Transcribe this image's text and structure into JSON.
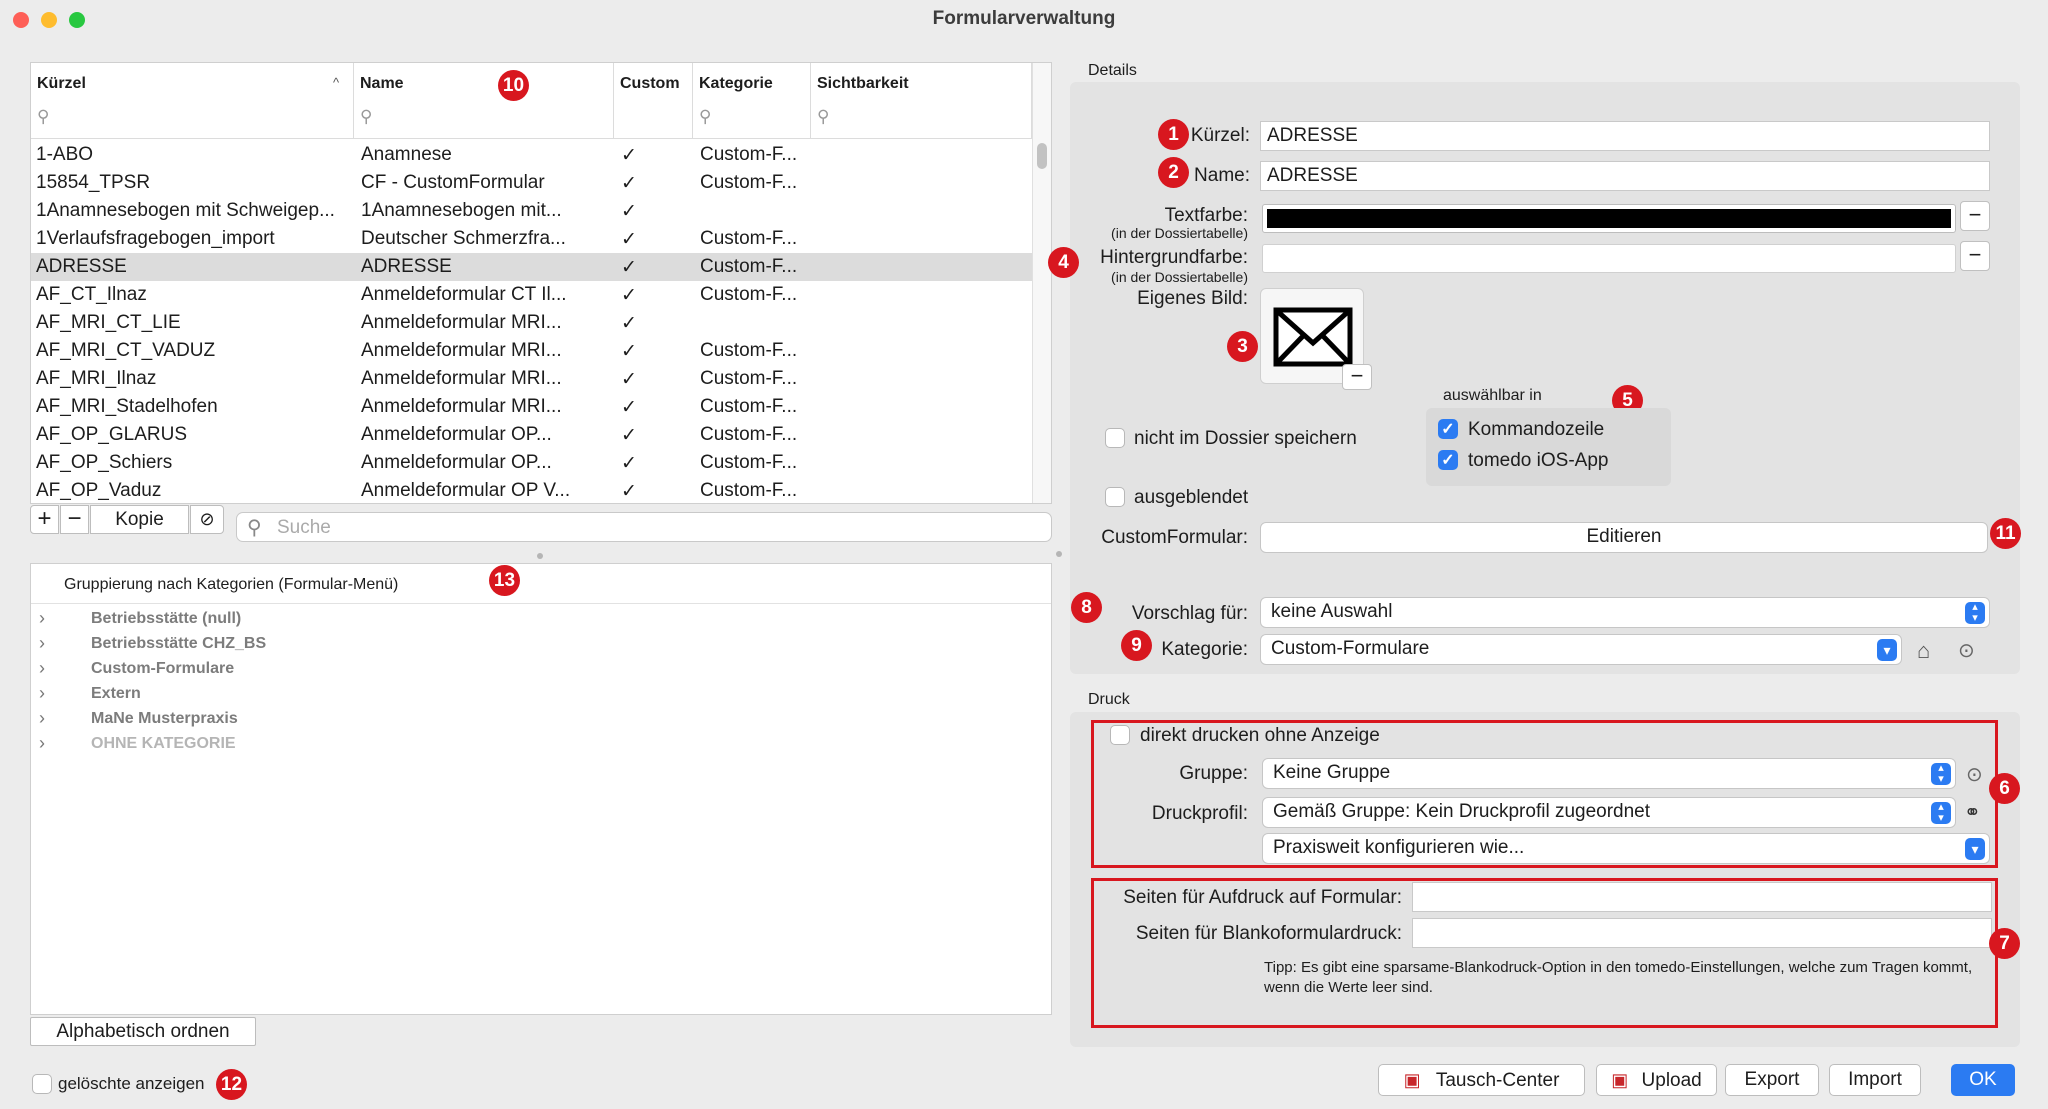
{
  "window": {
    "title": "Formularverwaltung"
  },
  "table": {
    "columns": [
      "Kürzel",
      "Name",
      "Custom",
      "Kategorie",
      "Sichtbarkeit"
    ],
    "rows": [
      [
        "1-ABO",
        "Anamnese",
        "✓",
        "Custom-F..."
      ],
      [
        "15854_TPSR",
        "CF - CustomFormular",
        "✓",
        "Custom-F..."
      ],
      [
        "1Anamnesebogen mit Schweigep...",
        "1Anamnesebogen mit...",
        "✓",
        ""
      ],
      [
        "1Verlaufsfragebogen_import",
        "Deutscher Schmerzfra...",
        "✓",
        "Custom-F..."
      ],
      [
        "ADRESSE",
        "ADRESSE",
        "✓",
        "Custom-F..."
      ],
      [
        "AF_CT_Ilnaz",
        "Anmeldeformular CT Il...",
        "✓",
        "Custom-F..."
      ],
      [
        "AF_MRI_CT_LIE",
        "Anmeldeformular MRI...",
        "✓",
        ""
      ],
      [
        "AF_MRI_CT_VADUZ",
        "Anmeldeformular MRI...",
        "✓",
        "Custom-F..."
      ],
      [
        "AF_MRI_Ilnaz",
        "Anmeldeformular MRI...",
        "✓",
        "Custom-F..."
      ],
      [
        "AF_MRI_Stadelhofen",
        "Anmeldeformular MRI...",
        "✓",
        "Custom-F..."
      ],
      [
        "AF_OP_GLARUS",
        "Anmeldeformular OP...",
        "✓",
        "Custom-F..."
      ],
      [
        "AF_OP_Schiers",
        "Anmeldeformular OP...",
        "✓",
        "Custom-F..."
      ],
      [
        "AF_OP_Vaduz",
        "Anmeldeformular OP V...",
        "✓",
        "Custom-F..."
      ]
    ],
    "selected_index": 4
  },
  "table_toolbar": {
    "add": "+",
    "remove": "−",
    "copy": "Kopie",
    "search_placeholder": "Suche"
  },
  "grouping": {
    "title": "Gruppierung nach Kategorien (Formular-Menü)",
    "items": [
      "Betriebsstätte (null)",
      "Betriebsstätte CHZ_BS",
      "Custom-Formulare",
      "Extern",
      "MaNe Musterpraxis",
      "OHNE KATEGORIE"
    ],
    "sort_button": "Alphabetisch ordnen"
  },
  "show_deleted": "gelöschte anzeigen",
  "details": {
    "section": "Details",
    "kuerzel_label": "Kürzel:",
    "kuerzel_value": "ADRESSE",
    "name_label": "Name:",
    "name_value": "ADRESSE",
    "textfarbe_label": "Textfarbe:",
    "textfarbe_sub": "(in der Dossiertabelle)",
    "hintergrund_label": "Hintergrundfarbe:",
    "hintergrund_sub": "(in der Dossiertabelle)",
    "bild_label": "Eigenes Bild:",
    "auswaehlbar_label": "auswählbar in",
    "kommandozeile": "Kommandozeile",
    "ios_app": "tomedo iOS-App",
    "nicht_speichern": "nicht im Dossier speichern",
    "ausgeblendet": "ausgeblendet",
    "customformular_label": "CustomFormular:",
    "editieren": "Editieren",
    "vorschlag_label": "Vorschlag für:",
    "vorschlag_value": "keine Auswahl",
    "kategorie_label": "Kategorie:",
    "kategorie_value": "Custom-Formulare"
  },
  "druck": {
    "section": "Druck",
    "direkt": "direkt drucken ohne Anzeige",
    "gruppe_label": "Gruppe:",
    "gruppe_value": "Keine Gruppe",
    "profil_label": "Druckprofil:",
    "profil_value": "Gemäß Gruppe: Kein Druckprofil zugeordnet",
    "praxisweit": "Praxisweit konfigurieren wie...",
    "seiten_aufdruck": "Seiten für Aufdruck auf Formular:",
    "seiten_blanko": "Seiten für Blankoformulardruck:",
    "tipp": "Tipp: Es gibt eine sparsame-Blankodruck-Option in den tomedo-Einstellungen, welche zum Tragen kommt, wenn die Werte leer sind."
  },
  "bottom_buttons": {
    "tausch": "Tausch-Center",
    "upload": "Upload",
    "export": "Export",
    "import": "Import",
    "ok": "OK"
  },
  "badges": [
    "1",
    "2",
    "3",
    "4",
    "5",
    "6",
    "7",
    "8",
    "9",
    "10",
    "11",
    "12",
    "13"
  ],
  "colors": {
    "accent": "#2b7bf2",
    "badge": "#d8171f"
  }
}
